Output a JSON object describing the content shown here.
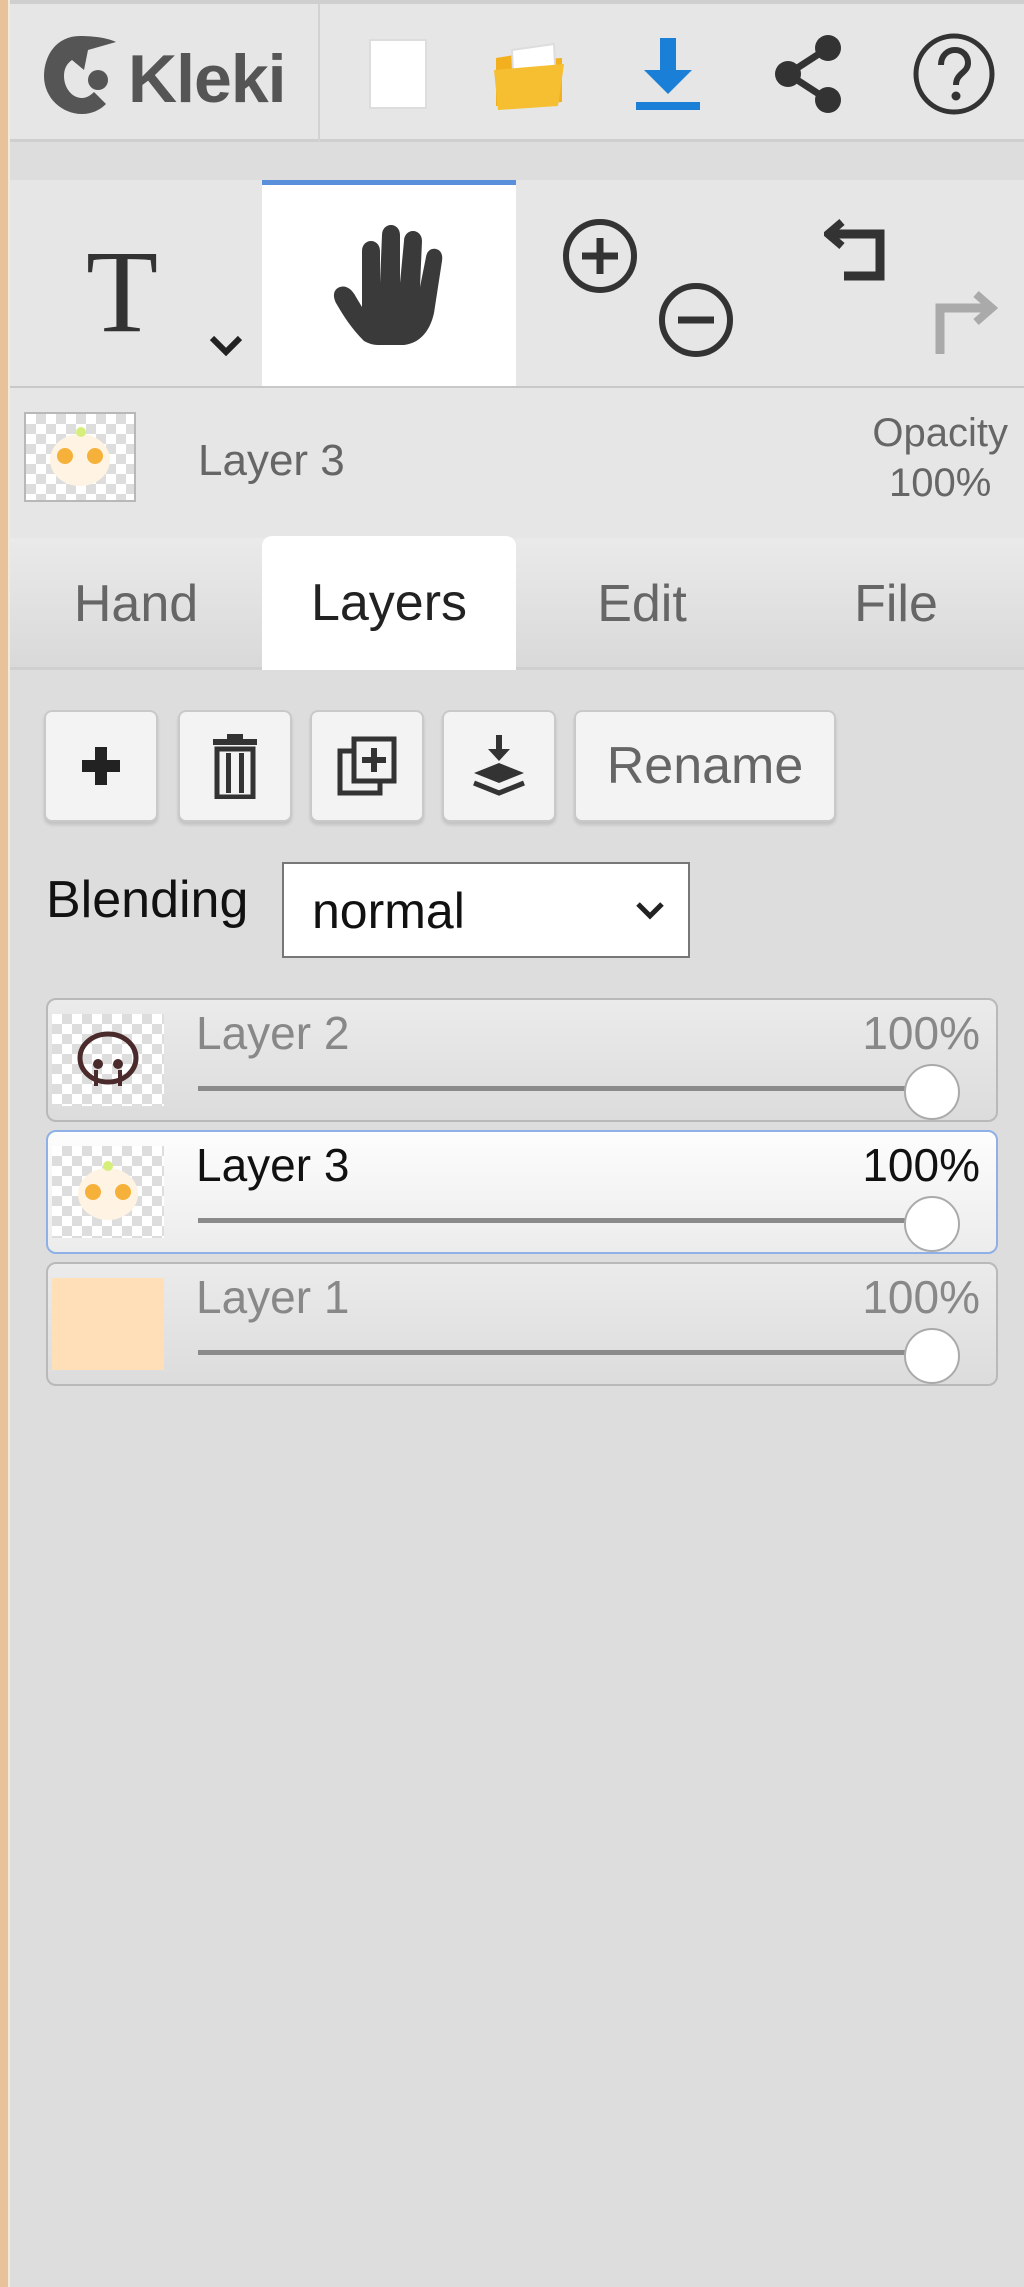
{
  "app": {
    "name": "Kleki"
  },
  "topbar": {
    "buttons": [
      {
        "name": "new-image-button",
        "icon": "new-page-icon"
      },
      {
        "name": "open-button",
        "icon": "folder-icon"
      },
      {
        "name": "save-button",
        "icon": "download-icon"
      },
      {
        "name": "share-button",
        "icon": "share-icon"
      },
      {
        "name": "help-button",
        "icon": "help-icon"
      }
    ]
  },
  "tools": {
    "text_tool_glyph": "T",
    "active": "hand",
    "items": [
      "text-tool",
      "hand-tool",
      "zoom-in",
      "zoom-out",
      "undo",
      "redo"
    ]
  },
  "current_layer": {
    "name": "Layer 3",
    "opacity_label": "Opacity",
    "opacity_value": "100%"
  },
  "tabs": [
    {
      "label": "Hand",
      "active": false
    },
    {
      "label": "Layers",
      "active": true
    },
    {
      "label": "Edit",
      "active": false
    },
    {
      "label": "File",
      "active": false
    }
  ],
  "layer_actions": {
    "rename_label": "Rename"
  },
  "blending": {
    "label": "Blending",
    "value": "normal"
  },
  "layers": [
    {
      "name": "Layer 2",
      "opacity": "100%",
      "opacity_level": 1.0,
      "selected": false
    },
    {
      "name": "Layer 3",
      "opacity": "100%",
      "opacity_level": 1.0,
      "selected": true
    },
    {
      "name": "Layer 1",
      "opacity": "100%",
      "opacity_level": 1.0,
      "selected": false
    }
  ],
  "colors": {
    "accent": "#5a8fdc",
    "download_blue": "#1a7fd6",
    "folder_yellow": "#f2b01e",
    "layer1_fill": "#ffdfb8"
  }
}
